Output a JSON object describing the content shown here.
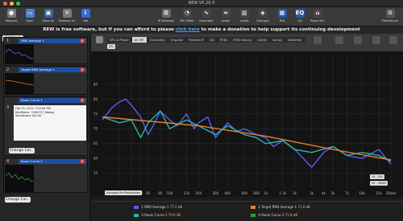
{
  "window": {
    "title": "REW V5.20.4",
    "traffic_lights": [
      "#ff5f57",
      "#febc2e",
      "#28c840"
    ]
  },
  "toolbar": {
    "left": [
      {
        "label": "Measure",
        "icon": "microphone-icon",
        "color": "#7a7a7a"
      },
      {
        "label": "Open",
        "icon": "folder-icon",
        "color": "#4a7ec8"
      },
      {
        "label": "Save All",
        "icon": "save-icon",
        "color": "#3a5fa0"
      },
      {
        "label": "Remove All",
        "icon": "remove-icon",
        "color": "#7a7a7a"
      },
      {
        "label": "Info",
        "icon": "info-icon",
        "color": "#2c6fd6"
      }
    ],
    "right": [
      {
        "label": "SPL Meter",
        "icon": "spl-meter-icon",
        "color": "#444"
      },
      {
        "label": "Generator",
        "icon": "generator-icon",
        "color": "#444"
      },
      {
        "label": "Scope",
        "icon": "scope-icon",
        "color": "#444"
      },
      {
        "label": "Levels",
        "icon": "levels-icon",
        "color": "#444"
      },
      {
        "label": "Overlays",
        "icon": "overlays-icon",
        "color": "#444"
      },
      {
        "label": "RTA",
        "icon": "rta-icon",
        "color": "#2356a8"
      },
      {
        "label": "EQ",
        "icon": "eq-icon",
        "color": "#2356a8"
      },
      {
        "label": "Room Sim",
        "icon": "room-sim-icon",
        "color": "#444"
      }
    ],
    "left_aux": [
      {
        "label": "IR Windows",
        "icon": "ir-windows-icon",
        "color": "#666"
      },
      {
        "label": "Preferences",
        "icon": "gear-icon",
        "color": "#555"
      }
    ]
  },
  "banner": {
    "prefix": "REW is free software, but if you can afford to please",
    "link": "click here",
    "suffix": "to make a donation to help support its continuing development"
  },
  "sidebar": {
    "collapse_label": "Collapse",
    "measurements": [
      {
        "title": "RMS Average 1",
        "number": "1",
        "button": "Change Cal..."
      },
      {
        "title": "Target RMS Average 1",
        "number": "2",
        "button": "Change Cal..."
      },
      {
        "title": "Room Curve 1",
        "number": "3",
        "button": "Change Cal...",
        "detail": [
          "Feb 15, 2022 7:50:58 PM",
          "Mic/Meter: 7058737_Meteg",
          "Soundcard: No Cal"
        ]
      },
      {
        "title": "Room Curve 2",
        "number": "4",
        "button": "Change Cal..."
      }
    ]
  },
  "graph_tabs": [
    "SPL & Phase",
    "All SPL",
    "Distortion",
    "Impulse",
    "Filtered IR",
    "GD",
    "RT60",
    "RT60 Decay",
    "Clarity",
    "Decay",
    "Waterfall"
  ],
  "active_tab": "All SPL",
  "capture_label": "Capture",
  "spl_selector": "SPL",
  "right_tools": [
    "Separate",
    "Scroll Bars",
    "Freq. Axis",
    "Limits",
    "Controls"
  ],
  "range_boxes": [
    "10 - 200",
    "20 - 20000"
  ],
  "average_button": "Average the Responses",
  "chart_data": {
    "type": "line",
    "xlabel": "",
    "ylabel": "dB",
    "xscale": "log",
    "xlim": [
      20,
      20000
    ],
    "ylim": [
      50,
      95
    ],
    "x_ticks": [
      "30",
      "40",
      "50",
      "60",
      "80",
      "100",
      "150",
      "200",
      "300",
      "400",
      "600",
      "800",
      "1k",
      "1.5k",
      "2k",
      "3k",
      "4k",
      "5k",
      "7k",
      "10k",
      "15k",
      "20kHz"
    ],
    "y_ticks": [
      "85",
      "80",
      "75",
      "70",
      "65",
      "60",
      "55"
    ],
    "grid": true,
    "series": [
      {
        "name": "RMS Average 1",
        "color": "#5b5bff",
        "x": [
          20,
          25,
          30,
          35,
          40,
          50,
          60,
          70,
          80,
          100,
          120,
          150,
          180,
          200,
          250,
          300,
          400,
          500,
          600,
          800,
          1000,
          1200,
          1500,
          2000,
          3000,
          4000,
          5000,
          7000,
          10000,
          15000,
          20000
        ],
        "y": [
          73,
          77,
          79,
          80,
          78,
          74,
          68,
          72,
          76,
          73,
          71,
          75,
          70,
          72,
          74,
          67,
          72,
          69,
          70,
          68,
          67,
          64,
          66,
          63,
          57,
          62,
          64,
          61,
          60,
          63,
          58
        ]
      },
      {
        "name": "Room Curve 1",
        "color": "#28b7a5",
        "x": [
          20,
          30,
          40,
          50,
          60,
          80,
          100,
          150,
          200,
          300,
          400,
          600,
          800,
          1000,
          1500,
          2000,
          3000,
          5000,
          7000,
          10000,
          15000,
          20000
        ],
        "y": [
          74,
          72,
          73,
          67,
          72,
          76,
          70,
          73,
          71,
          68,
          71,
          68,
          67,
          65,
          66,
          63,
          62,
          64,
          61,
          62,
          61,
          59
        ]
      },
      {
        "name": "Target RMS Average 1",
        "color": "#e5802f",
        "x": [
          20,
          200,
          1000,
          5000,
          20000
        ],
        "y": [
          74,
          71,
          67.5,
          63,
          59.5
        ]
      }
    ]
  },
  "legend": [
    {
      "name": "RMS Average 1",
      "color": "#5b5bff",
      "value": "77.2 dB",
      "number": "1"
    },
    {
      "name": "Target RMS Average 1",
      "color": "#e5802f",
      "value": "71.8 dB",
      "number": "2"
    },
    {
      "name": "Room Curve 1",
      "color": "#28b7a5",
      "value": "79.0 dB",
      "number": "3"
    },
    {
      "name": "Room Curve 2",
      "color": "#2a9d4a",
      "value": "71.8 dB",
      "number": "4"
    }
  ]
}
